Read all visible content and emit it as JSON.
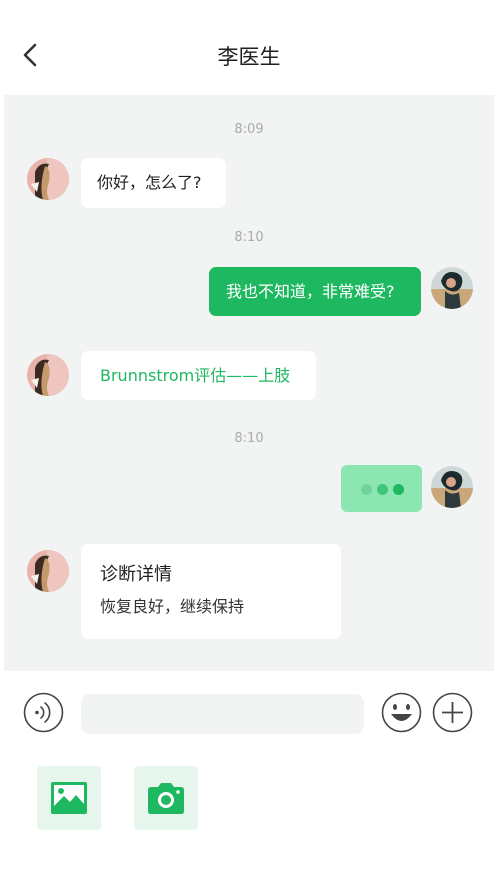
{
  "header": {
    "title": "李医生"
  },
  "colors": {
    "accent": "#1eb861",
    "bubble_pending": "#8ce6b1",
    "chat_background": "#f2f3f3",
    "timestamp": "#a9abae"
  },
  "messages": [
    {
      "type": "time",
      "text": "8:09"
    },
    {
      "type": "text",
      "from": "doctor",
      "text": "你好，怎么了?"
    },
    {
      "type": "time",
      "text": "8:10"
    },
    {
      "type": "text",
      "from": "me",
      "text": "我也不知道，非常难受?"
    },
    {
      "type": "link",
      "from": "doctor",
      "text": "Brunnstrom评估——上肢"
    },
    {
      "type": "time",
      "text": "8:10"
    },
    {
      "type": "typing",
      "from": "me"
    },
    {
      "type": "card",
      "from": "doctor",
      "title": "诊断详情",
      "text": "恢复良好，继续保持"
    }
  ],
  "input_bar": {
    "voice_icon": "voice-icon",
    "emoji_icon": "smiley-icon",
    "plus_icon": "plus-icon",
    "input_value": ""
  },
  "tools": [
    {
      "icon": "image-icon"
    },
    {
      "icon": "camera-icon"
    }
  ]
}
